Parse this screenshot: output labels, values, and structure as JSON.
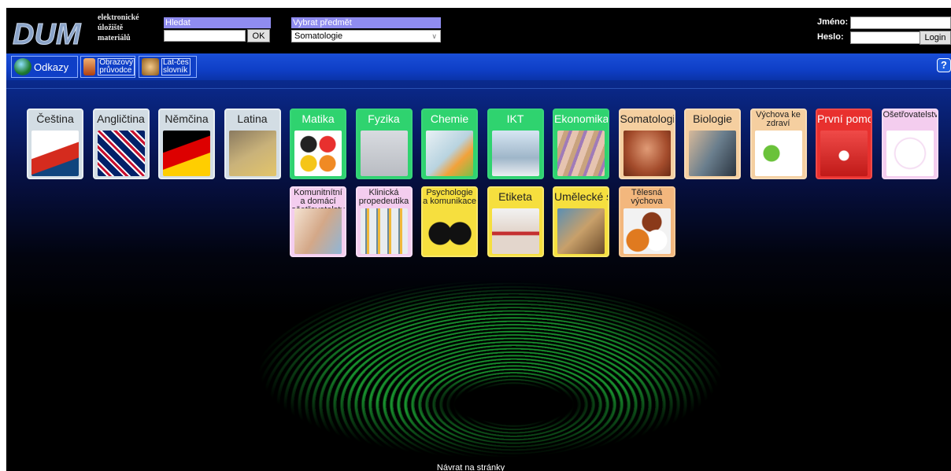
{
  "header": {
    "logo_text": "DUM",
    "tagline": [
      "elektronické",
      "úložiště",
      "materiálů"
    ],
    "search_label": "Hledat",
    "search_value": "",
    "ok_label": "OK",
    "subject_label": "Vybrat předmět",
    "subject_selected": "Somatologie",
    "name_label": "Jméno:",
    "password_label": "Heslo:",
    "login_label": "Login"
  },
  "nav": {
    "links_label": "Odkazy",
    "guide_label": [
      "Obrazový",
      "průvodce"
    ],
    "dict_label": [
      "Lat-čes",
      "slovník"
    ],
    "help_label": "?"
  },
  "subjects_row1": [
    {
      "label": "Čeština",
      "style": "lang",
      "icon": "czech-flag-book-icon"
    },
    {
      "label": "Angličtina",
      "style": "lang",
      "icon": "uk-flag-book-icon"
    },
    {
      "label": "Němčina",
      "style": "lang",
      "icon": "german-flag-book-icon"
    },
    {
      "label": "Latina",
      "style": "lang",
      "icon": "latin-book-icon"
    },
    {
      "label": "Matika",
      "style": "green",
      "icon": "math-operators-icon"
    },
    {
      "label": "Fyzika",
      "style": "green",
      "icon": "newtons-cradle-icon"
    },
    {
      "label": "Chemie",
      "style": "green",
      "icon": "lab-flasks-icon"
    },
    {
      "label": "IKT",
      "style": "green",
      "icon": "computer-icon"
    },
    {
      "label": "Ekonomika",
      "style": "green",
      "icon": "banknotes-icon"
    },
    {
      "label": "Somatologie",
      "style": "peach",
      "icon": "anatomy-icon"
    },
    {
      "label": "Biologie",
      "style": "peach",
      "icon": "microscope-icon"
    },
    {
      "label": "Výchova ke zdraví",
      "style": "peach",
      "icon": "apple-heartbeat-icon"
    },
    {
      "label": "První pomoc",
      "style": "red",
      "icon": "first-aid-kit-icon"
    },
    {
      "label": "Ošetřovatelství",
      "style": "pink",
      "icon": "stethoscope-icon"
    }
  ],
  "subjects_row2": [
    {
      "label": "Komunitnítní a domácí ošetřovatelství",
      "style": "pink",
      "icon": "caring-hands-icon"
    },
    {
      "label": "Klinická propedeutika",
      "style": "pink",
      "icon": "test-tubes-icon"
    },
    {
      "label": "Psychologie a komunikace",
      "style": "yellow",
      "icon": "heads-silhouette-icon"
    },
    {
      "label": "Etiketa",
      "style": "yellow",
      "icon": "bow-tie-icon"
    },
    {
      "label": "Umělecké směry",
      "style": "yellow",
      "icon": "melting-clock-icon"
    },
    {
      "label": "Tělesná výchova",
      "style": "orange",
      "icon": "sports-balls-icon"
    }
  ],
  "footer_link": "Návrat na stránky"
}
